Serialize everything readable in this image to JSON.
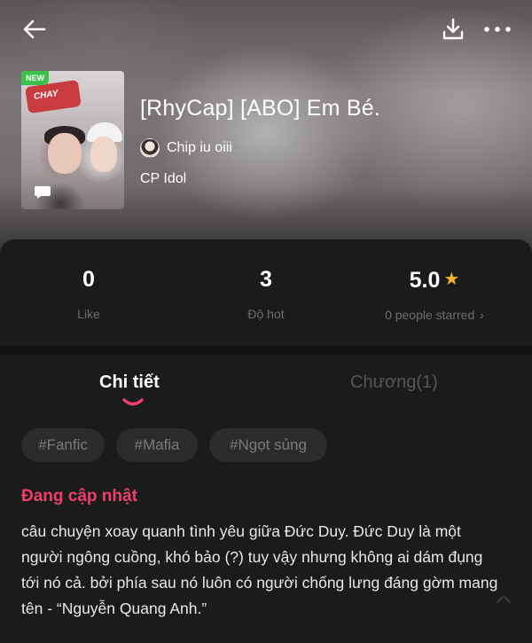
{
  "header": {
    "back_icon": "arrow-left-icon",
    "download_icon": "download-icon",
    "more_icon": "more-dots-icon"
  },
  "book": {
    "badge": "NEW",
    "cover_text": "CHAY",
    "title": "[RhyCap] [ABO] Em Bé.",
    "author": "Chip iu oiii",
    "category": "CP Idol"
  },
  "stats": [
    {
      "value": "0",
      "label": "Like"
    },
    {
      "value": "3",
      "label": "Độ hot"
    },
    {
      "value": "5.0",
      "label": "0 people starred"
    }
  ],
  "tabs": {
    "detail": "Chi tiết",
    "chapters": "Chương(1)"
  },
  "tags": [
    "#Fanfic",
    "#Mafia",
    "#Ngọt sủng"
  ],
  "status": "Đang cập nhật",
  "description": "câu chuyện xoay quanh tình yêu giữa Đức Duy. Đức Duy là một người ngông cuồng, khó bảo (?) tuy vậy nhưng không ai dám đụng tới nó cả. bởi phía sau nó luôn có người chống lưng đáng gờm mang tên - “Nguyễn Quang Anh.”",
  "colors": {
    "accent": "#ee3f6b",
    "star": "#f6b22a",
    "badge": "#3cc24a",
    "panel": "#1b1b1b"
  }
}
